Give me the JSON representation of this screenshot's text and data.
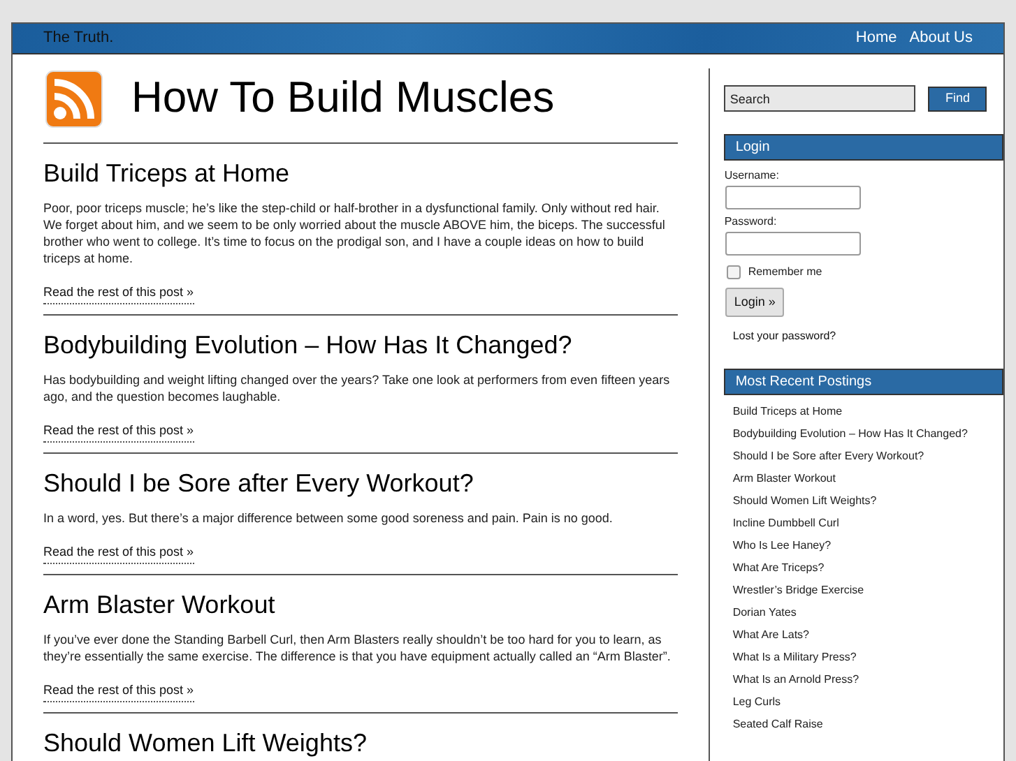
{
  "topbar": {
    "tagline": "The Truth.",
    "nav": [
      {
        "label": "Home"
      },
      {
        "label": "About Us"
      }
    ]
  },
  "site_title": "How To Build Muscles",
  "posts": [
    {
      "title": "Build Triceps at Home",
      "excerpt": "Poor, poor triceps muscle; he’s like the step-child or half-brother in a dysfunctional family. Only without red hair. We forget about him, and we seem to be only worried about the muscle ABOVE him, the biceps. The successful brother who went to college. It’s time to focus on the prodigal son, and I have a couple ideas on how to build triceps at home.",
      "more": "Read the rest of this post »"
    },
    {
      "title": "Bodybuilding Evolution – How Has It Changed?",
      "excerpt": "Has bodybuilding and weight lifting changed over the years? Take one look at performers from even fifteen years ago, and the question becomes laughable.",
      "more": "Read the rest of this post »"
    },
    {
      "title": "Should I be Sore after Every Workout?",
      "excerpt": "In a word, yes. But there’s a major difference between some good soreness and pain. Pain is no good.",
      "more": "Read the rest of this post »"
    },
    {
      "title": "Arm Blaster Workout",
      "excerpt": "If you’ve ever done the Standing Barbell Curl, then Arm Blasters really shouldn’t be too hard for you to learn, as they’re essentially the same exercise. The difference is that you have equipment actually called an “Arm Blaster”.",
      "more": "Read the rest of this post »"
    },
    {
      "title": "Should Women Lift Weights?"
    }
  ],
  "search": {
    "placeholder": "Search",
    "button": "Find"
  },
  "login": {
    "heading": "Login",
    "username_label": "Username:",
    "password_label": "Password:",
    "remember": {
      "label": "Remember me",
      "checked": false
    },
    "button": "Login »",
    "lost": "Lost your password?"
  },
  "recent": {
    "heading": "Most Recent Postings",
    "items": [
      "Build Triceps at Home",
      "Bodybuilding Evolution – How Has It Changed?",
      "Should I be Sore after Every Workout?",
      "Arm Blaster Workout",
      "Should Women Lift Weights?",
      "Incline Dumbbell Curl",
      "Who Is Lee Haney?",
      "What Are Triceps?",
      "Wrestler’s Bridge Exercise",
      "Dorian Yates",
      "What Are Lats?",
      "What Is a Military Press?",
      "What Is an Arnold Press?",
      "Leg Curls",
      "Seated Calf Raise"
    ]
  }
}
